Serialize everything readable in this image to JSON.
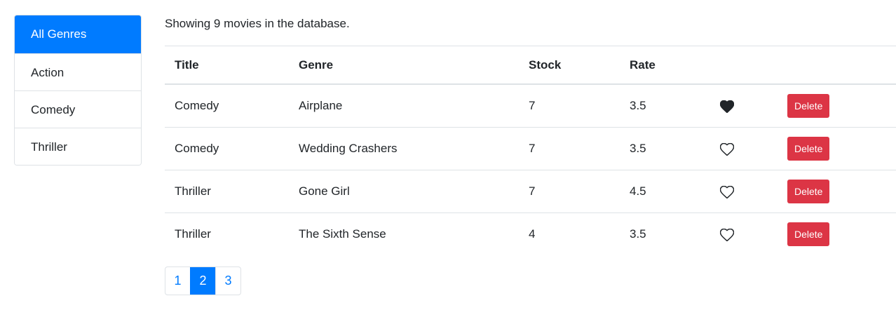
{
  "colors": {
    "primary": "#007bff",
    "danger": "#dc3545",
    "border": "#dee2e6",
    "text": "#212529"
  },
  "sidebar": {
    "genres": [
      {
        "label": "All Genres",
        "active": true
      },
      {
        "label": "Action",
        "active": false
      },
      {
        "label": "Comedy",
        "active": false
      },
      {
        "label": "Thriller",
        "active": false
      }
    ]
  },
  "summary": "Showing 9 movies in the database.",
  "table": {
    "headers": {
      "title": "Title",
      "genre": "Genre",
      "stock": "Stock",
      "rate": "Rate"
    },
    "rows": [
      {
        "title": "Comedy",
        "genre": "Airplane",
        "stock": "7",
        "rate": "3.5",
        "liked": true,
        "delete_label": "Delete"
      },
      {
        "title": "Comedy",
        "genre": "Wedding Crashers",
        "stock": "7",
        "rate": "3.5",
        "liked": false,
        "delete_label": "Delete"
      },
      {
        "title": "Thriller",
        "genre": "Gone Girl",
        "stock": "7",
        "rate": "4.5",
        "liked": false,
        "delete_label": "Delete"
      },
      {
        "title": "Thriller",
        "genre": "The Sixth Sense",
        "stock": "4",
        "rate": "3.5",
        "liked": false,
        "delete_label": "Delete"
      }
    ]
  },
  "pagination": {
    "pages": [
      {
        "label": "1",
        "active": false
      },
      {
        "label": "2",
        "active": true
      },
      {
        "label": "3",
        "active": false
      }
    ]
  }
}
